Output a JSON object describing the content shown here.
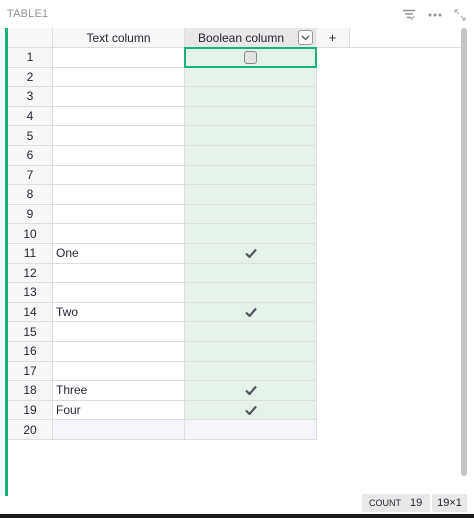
{
  "widget": {
    "title": "TABLE1",
    "sort_filter_icon": "sort-filter-icon",
    "more_icon": "more-horizontal-icon",
    "expand_icon": "expand-icon"
  },
  "columns": {
    "text_header": "Text column",
    "bool_header": "Boolean column",
    "add_label": "+"
  },
  "rows": [
    {
      "num": "1",
      "text": "",
      "checked": false
    },
    {
      "num": "2",
      "text": "",
      "checked": false
    },
    {
      "num": "3",
      "text": "",
      "checked": false
    },
    {
      "num": "4",
      "text": "",
      "checked": false
    },
    {
      "num": "5",
      "text": "",
      "checked": false
    },
    {
      "num": "6",
      "text": "",
      "checked": false
    },
    {
      "num": "7",
      "text": "",
      "checked": false
    },
    {
      "num": "8",
      "text": "",
      "checked": false
    },
    {
      "num": "9",
      "text": "",
      "checked": false
    },
    {
      "num": "10",
      "text": "",
      "checked": false
    },
    {
      "num": "11",
      "text": "One",
      "checked": true
    },
    {
      "num": "12",
      "text": "",
      "checked": false
    },
    {
      "num": "13",
      "text": "",
      "checked": false
    },
    {
      "num": "14",
      "text": "Two",
      "checked": true
    },
    {
      "num": "15",
      "text": "",
      "checked": false
    },
    {
      "num": "16",
      "text": "",
      "checked": false
    },
    {
      "num": "17",
      "text": "",
      "checked": false
    },
    {
      "num": "18",
      "text": "Three",
      "checked": true
    },
    {
      "num": "19",
      "text": "Four",
      "checked": true
    }
  ],
  "add_row": {
    "num": "20"
  },
  "footer": {
    "count_label": "COUNT",
    "count_value": "19",
    "dimensions": "19×1"
  },
  "colors": {
    "accent": "#16b378",
    "selected_column": "#e4f2ea"
  }
}
